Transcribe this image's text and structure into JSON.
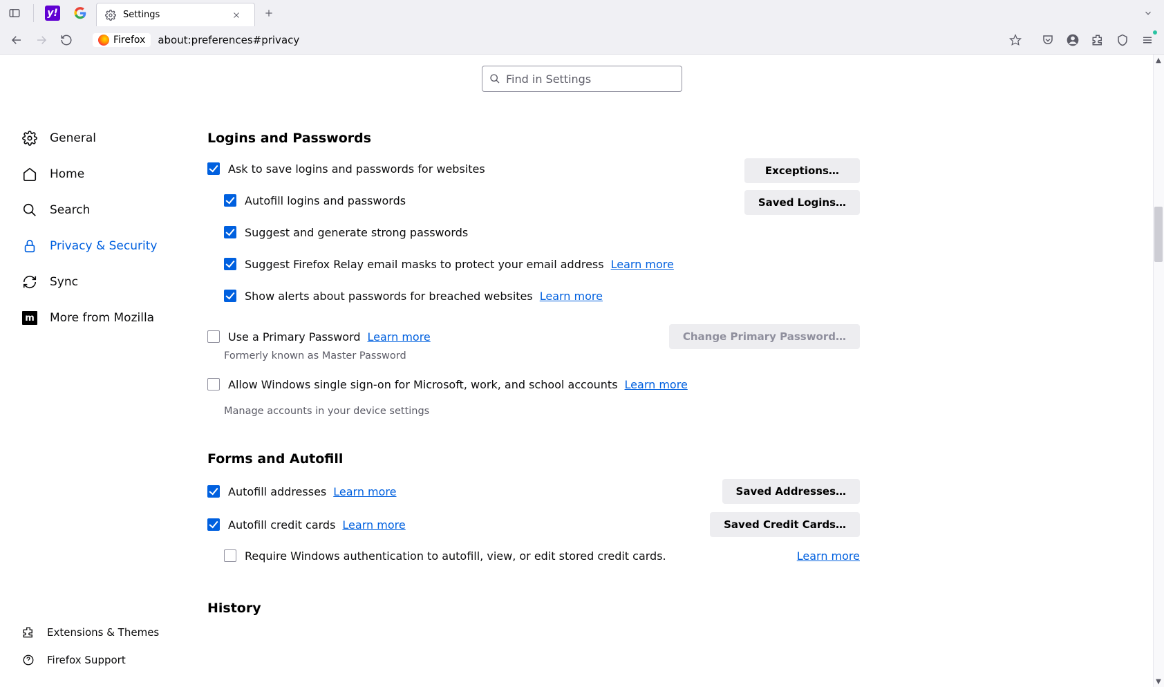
{
  "browser": {
    "tab_title": "Settings",
    "addr_label": "Firefox",
    "url": "about:preferences#privacy"
  },
  "search": {
    "placeholder": "Find in Settings"
  },
  "sidebar": {
    "items": [
      {
        "label": "General"
      },
      {
        "label": "Home"
      },
      {
        "label": "Search"
      },
      {
        "label": "Privacy & Security"
      },
      {
        "label": "Sync"
      },
      {
        "label": "More from Mozilla"
      }
    ],
    "bottom": [
      {
        "label": "Extensions & Themes"
      },
      {
        "label": "Firefox Support"
      }
    ]
  },
  "sections": {
    "logins": {
      "title": "Logins and Passwords",
      "ask_save": "Ask to save logins and passwords for websites",
      "autofill": "Autofill logins and passwords",
      "suggest_strong": "Suggest and generate strong passwords",
      "relay": "Suggest Firefox Relay email masks to protect your email address",
      "breach": "Show alerts about passwords for breached websites",
      "primary": "Use a Primary Password",
      "primary_hint": "Formerly known as Master Password",
      "sso": "Allow Windows single sign-on for Microsoft, work, and school accounts",
      "sso_hint": "Manage accounts in your device settings",
      "btn_exceptions": "Exceptions…",
      "btn_saved_logins": "Saved Logins…",
      "btn_change_pp": "Change Primary Password…",
      "learn_more": "Learn more"
    },
    "forms": {
      "title": "Forms and Autofill",
      "addresses": "Autofill addresses",
      "cards": "Autofill credit cards",
      "require_auth": "Require Windows authentication to autofill, view, or edit stored credit cards.",
      "btn_saved_addr": "Saved Addresses…",
      "btn_saved_cards": "Saved Credit Cards…",
      "learn_more": "Learn more"
    },
    "history": {
      "title": "History"
    }
  }
}
